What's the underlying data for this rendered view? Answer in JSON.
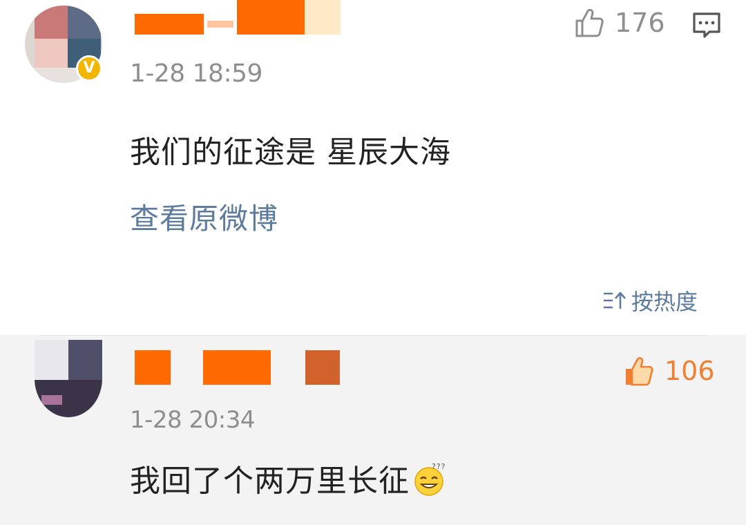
{
  "post": {
    "timestamp": "1-28 18:59",
    "content": "我们的征途是  星辰大海",
    "view_original_label": "查看原微博",
    "like_count": "176",
    "verified_badge": "V",
    "icons": {
      "like": "thumbs-up-outline-icon",
      "reply": "comment-bubble-icon",
      "verified": "verified-v-badge-icon"
    }
  },
  "sort": {
    "label": "按热度",
    "icon": "sort-arrows-icon"
  },
  "reply": {
    "timestamp": "1-28 20:34",
    "content": "我回了个两万里长征",
    "emoji": "dizzy-face-emoji",
    "like_count": "106",
    "icons": {
      "like": "thumbs-up-filled-icon"
    }
  },
  "colors": {
    "link": "#5d7c9d",
    "meta_gray": "#8e8e8e",
    "text": "#222222",
    "liked_orange": "#f07f32",
    "reply_bg": "#f3f3f3",
    "badge_gold": "#f2b600"
  }
}
